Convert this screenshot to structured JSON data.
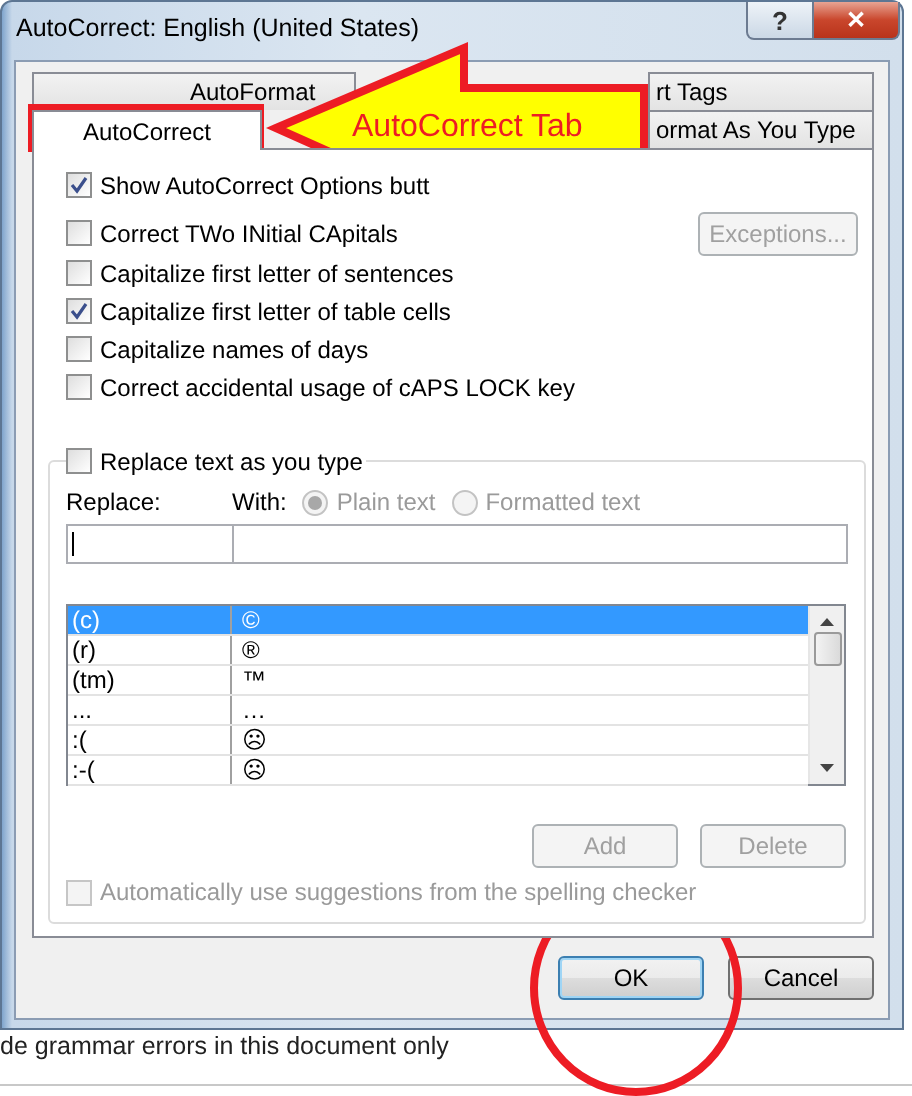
{
  "window": {
    "title": "AutoCorrect: English (United States)",
    "help_button": "?",
    "close_button": "✕"
  },
  "tab_rows": [
    {
      "tabs": [
        {
          "label": "AutoFormat",
          "selected": false
        },
        {
          "label": "rt Tags",
          "selected": false
        }
      ]
    },
    {
      "tabs": [
        {
          "label": "AutoCorrect",
          "selected": true
        },
        {
          "label": "ormat As You Type",
          "selected": false
        }
      ]
    }
  ],
  "options": [
    {
      "label": "Show AutoCorrect Options butt",
      "checked": true
    },
    {
      "label": "Correct TWo INitial CApitals",
      "checked": false
    },
    {
      "label": "Capitalize first letter of sentences",
      "checked": false
    },
    {
      "label": "Capitalize first letter of table cells",
      "checked": true
    },
    {
      "label": "Capitalize names of days",
      "checked": false
    },
    {
      "label": "Correct accidental usage of cAPS LOCK key",
      "checked": false
    }
  ],
  "exceptions_button": {
    "label": "Exceptions...",
    "disabled": true
  },
  "replace_group": {
    "checkbox": {
      "label": "Replace text as you type",
      "checked": false
    },
    "replace_label": "Replace:",
    "with_label": "With:",
    "format_options": [
      {
        "label": "Plain text",
        "selected": true,
        "disabled": true
      },
      {
        "label": "Formatted text",
        "selected": false,
        "disabled": true
      }
    ],
    "entries": [
      {
        "replace": "(c)",
        "with": "©",
        "selected": true
      },
      {
        "replace": "(r)",
        "with": "®",
        "selected": false
      },
      {
        "replace": "(tm)",
        "with": "™",
        "selected": false
      },
      {
        "replace": "...",
        "with": "…",
        "selected": false
      },
      {
        "replace": ":(",
        "with": "☹",
        "selected": false
      },
      {
        "replace": ":-(",
        "with": "☹",
        "selected": false
      }
    ],
    "add_button": {
      "label": "Add",
      "disabled": true
    },
    "delete_button": {
      "label": "Delete",
      "disabled": true
    },
    "spelling_option": {
      "label": "Automatically use suggestions from the spelling checker",
      "checked": false,
      "disabled": true
    }
  },
  "buttons": [
    {
      "label": "OK",
      "default": true
    },
    {
      "label": "Cancel",
      "default": false
    }
  ],
  "annotation": {
    "callout": "AutoCorrect Tab"
  },
  "background_text": "de grammar errors in this document only"
}
